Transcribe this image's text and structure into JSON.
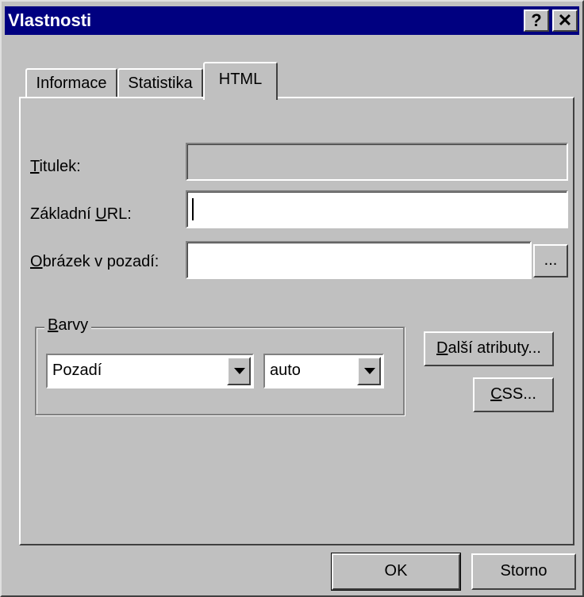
{
  "window": {
    "title": "Vlastnosti",
    "help_glyph": "?",
    "close_glyph": "✕"
  },
  "tabs": [
    {
      "label": "Informace"
    },
    {
      "label": "Statistika"
    },
    {
      "label": "HTML",
      "active": true
    }
  ],
  "form": {
    "titulek": {
      "label_first": "T",
      "label_rest": "itulek:",
      "value": ""
    },
    "zakladni_url": {
      "label_pre": "Základní ",
      "label_acc": "U",
      "label_rest": "RL:",
      "value": ""
    },
    "obrazek": {
      "label_first": "O",
      "label_rest": "brázek v pozadí:",
      "value": "",
      "browse_label": "..."
    }
  },
  "barvy": {
    "legend_first": "B",
    "legend_rest": "arvy",
    "element_select": "Pozadí",
    "color_select": "auto"
  },
  "buttons": {
    "dalsi_first": "D",
    "dalsi_rest": "alší atributy...",
    "css_first": "C",
    "css_rest": "SS...",
    "ok": "OK",
    "storno": "Storno"
  },
  "icons": {
    "help": "help-icon",
    "close": "close-icon",
    "dropdown": "chevron-down-icon"
  }
}
